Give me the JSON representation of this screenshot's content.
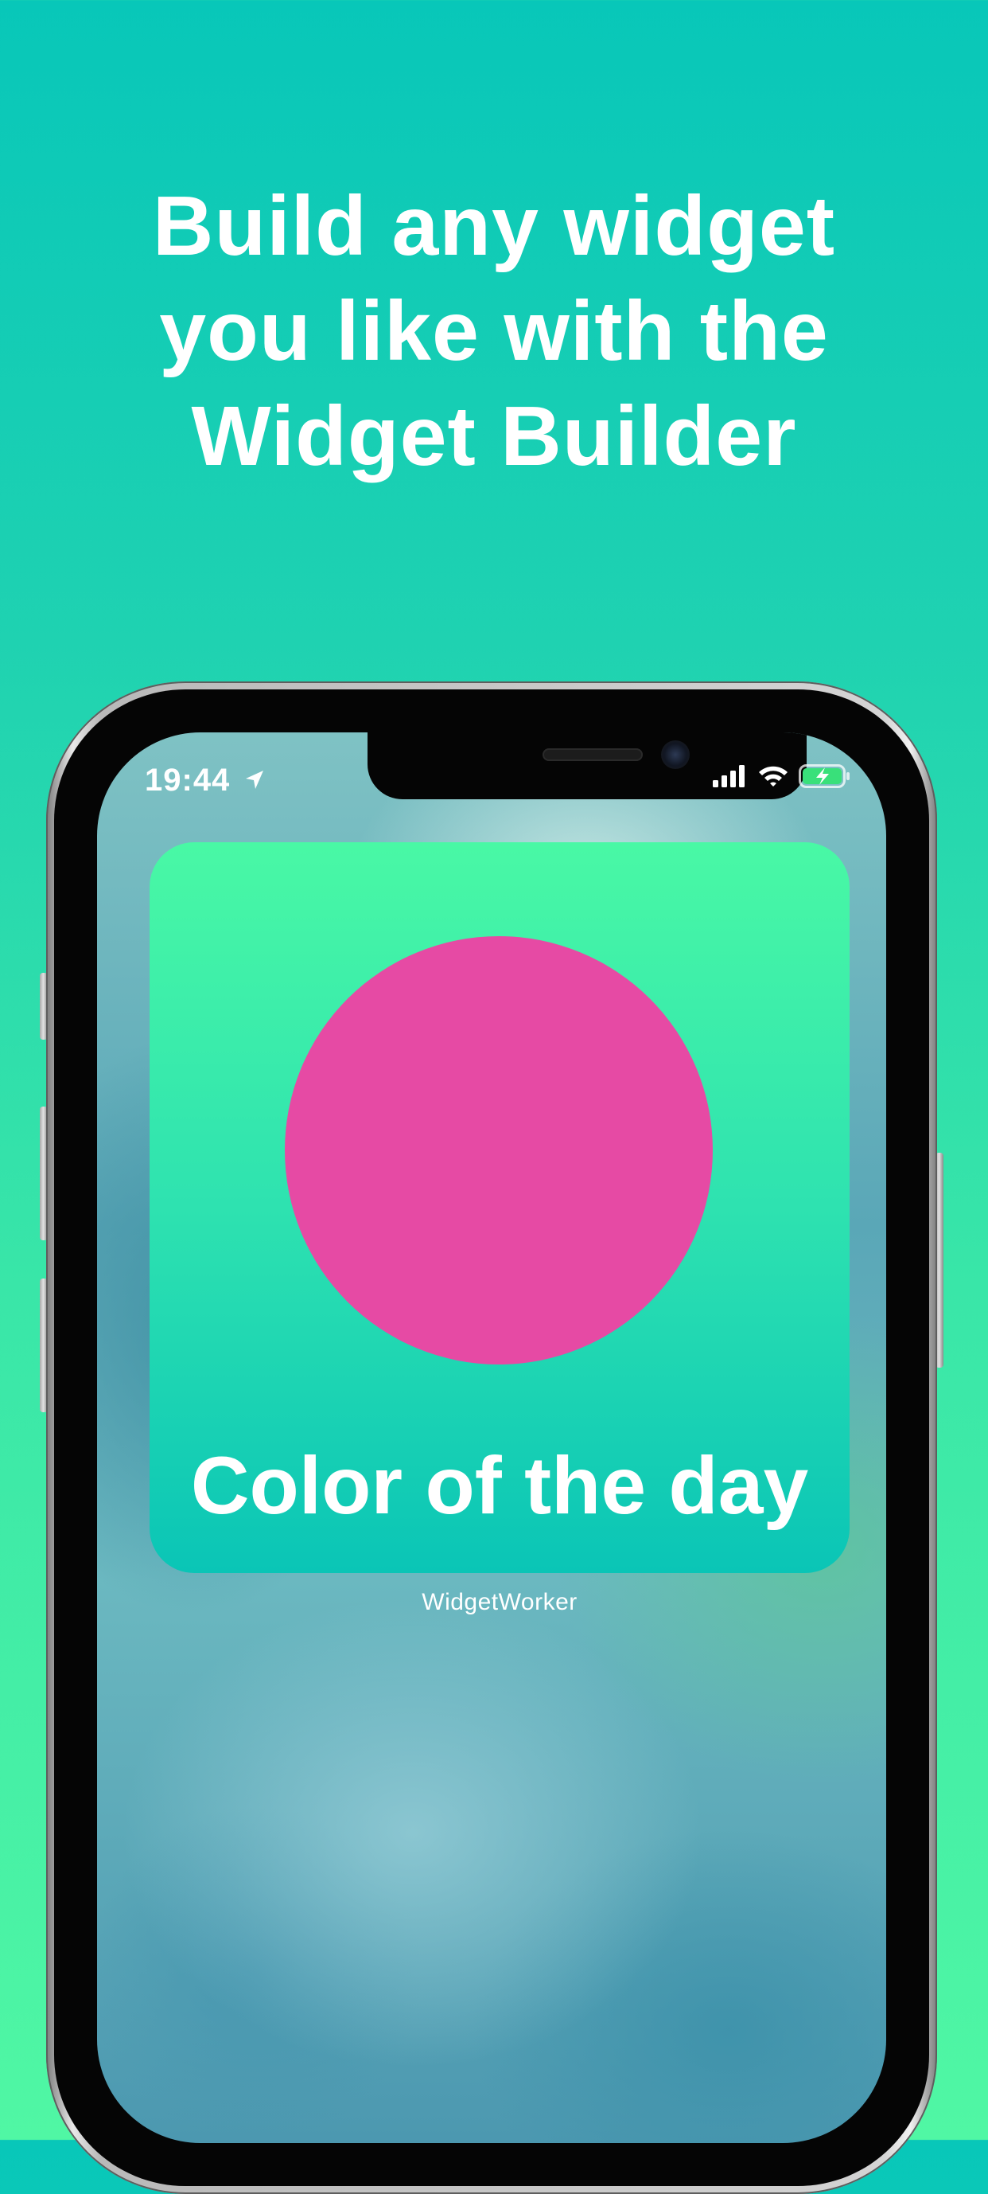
{
  "headline": {
    "lines": [
      "Build any widget",
      "you like with the",
      "Widget Builder"
    ]
  },
  "status_bar": {
    "time": "19:44",
    "icons": [
      "location-arrow-icon",
      "cellular-signal-icon",
      "wifi-icon",
      "battery-charging-icon"
    ]
  },
  "widget": {
    "label": "Color of the day",
    "circle_color": "#e64aa4",
    "app_name": "WidgetWorker"
  },
  "colors": {
    "background_top": "#08c7b9",
    "background_bottom": "#50f7a4",
    "widget_top": "#49f8a5",
    "widget_bottom": "#0ac5b6",
    "battery_charging": "#39e07a"
  }
}
